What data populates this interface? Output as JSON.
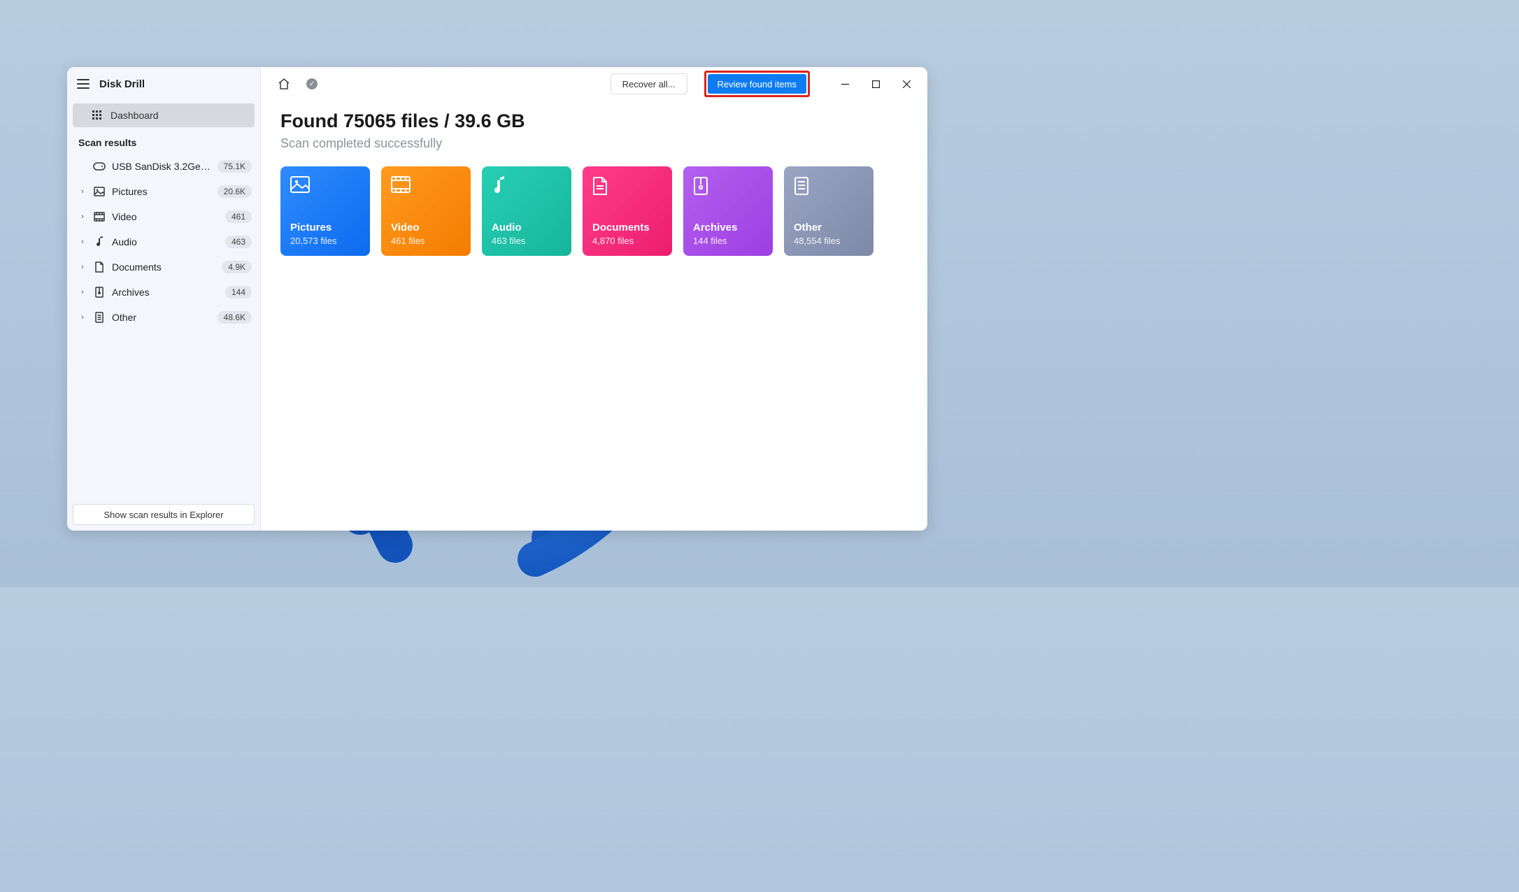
{
  "app": {
    "title": "Disk Drill"
  },
  "sidebar": {
    "dashboard": "Dashboard",
    "sectionLabel": "Scan results",
    "device": {
      "label": "USB  SanDisk 3.2Gen1...",
      "badge": "75.1K"
    },
    "items": [
      {
        "label": "Pictures",
        "badge": "20.6K"
      },
      {
        "label": "Video",
        "badge": "461"
      },
      {
        "label": "Audio",
        "badge": "463"
      },
      {
        "label": "Documents",
        "badge": "4.9K"
      },
      {
        "label": "Archives",
        "badge": "144"
      },
      {
        "label": "Other",
        "badge": "48.6K"
      }
    ],
    "explorerBtn": "Show scan results in Explorer"
  },
  "toolbar": {
    "recoverAll": "Recover all...",
    "reviewFound": "Review found items"
  },
  "main": {
    "title": "Found 75065 files / 39.6 GB",
    "subtitle": "Scan completed successfully",
    "cards": [
      {
        "title": "Pictures",
        "count": "20,573 files"
      },
      {
        "title": "Video",
        "count": "461 files"
      },
      {
        "title": "Audio",
        "count": "463 files"
      },
      {
        "title": "Documents",
        "count": "4,870 files"
      },
      {
        "title": "Archives",
        "count": "144 files"
      },
      {
        "title": "Other",
        "count": "48,554 files"
      }
    ]
  }
}
